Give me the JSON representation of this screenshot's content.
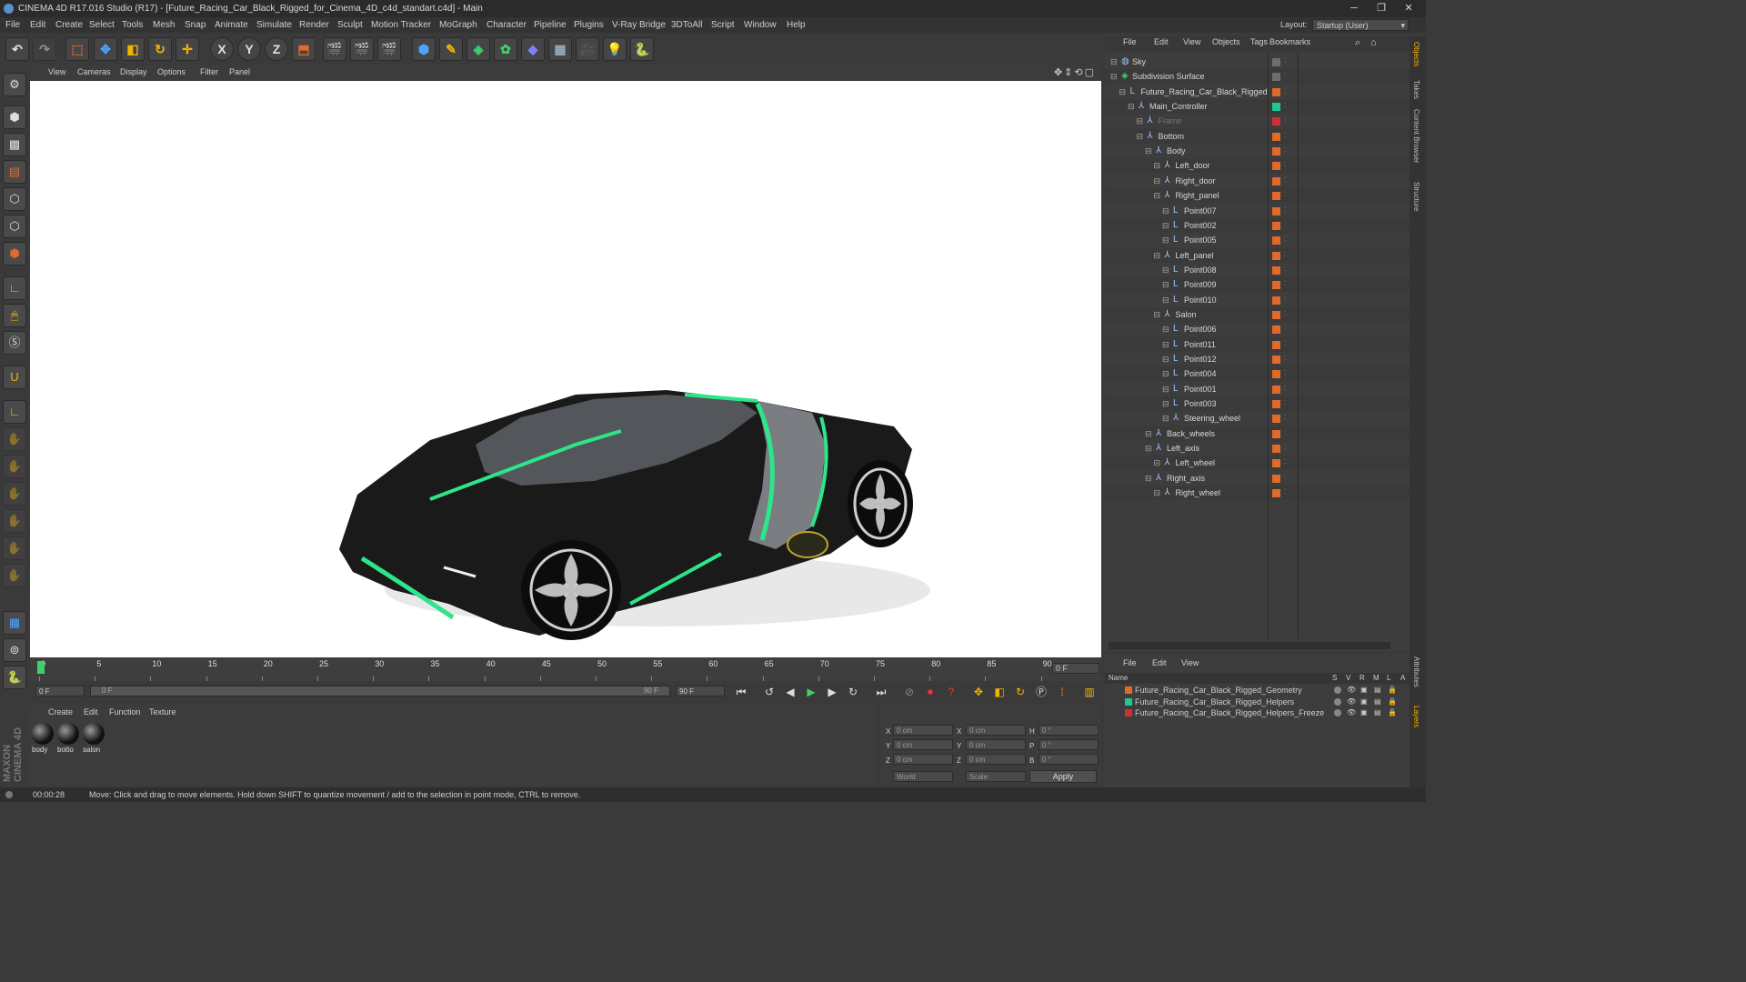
{
  "window": {
    "title": "CINEMA 4D R17.016 Studio (R17) - [Future_Racing_Car_Black_Rigged_for_Cinema_4D_c4d_standart.c4d] - Main",
    "min": "─",
    "max": "❐",
    "close": "✕"
  },
  "menu": [
    "File",
    "Edit",
    "Create",
    "Select",
    "Tools",
    "Mesh",
    "Snap",
    "Animate",
    "Simulate",
    "Render",
    "Sculpt",
    "Motion Tracker",
    "MoGraph",
    "Character",
    "Pipeline",
    "Plugins",
    "V-Ray Bridge",
    "3DToAll",
    "Script",
    "Window",
    "Help"
  ],
  "layout": {
    "label": "Layout:",
    "value": "Startup (User)"
  },
  "toolbar": {
    "x": "X",
    "y": "Y",
    "z": "Z"
  },
  "viewport_menu": [
    "View",
    "Cameras",
    "Display",
    "Options",
    "Filter",
    "Panel"
  ],
  "object_menu": [
    "File",
    "Edit",
    "View",
    "Objects",
    "Tags",
    "Bookmarks"
  ],
  "objects": [
    {
      "name": "Sky",
      "depth": 0,
      "icon": "sky-icon",
      "color": "#6e6e6e"
    },
    {
      "name": "Subdivision Surface",
      "depth": 0,
      "icon": "subdivision-icon",
      "color": "#6e6e6e"
    },
    {
      "name": "Future_Racing_Car_Black_Rigged",
      "depth": 1,
      "icon": "null-icon",
      "color": "#e06a2a"
    },
    {
      "name": "Main_Controller",
      "depth": 2,
      "icon": "joint-icon",
      "color": "#20c890"
    },
    {
      "name": "Frame",
      "depth": 3,
      "icon": "joint-icon",
      "color": "#d03030"
    },
    {
      "name": "Bottom",
      "depth": 3,
      "icon": "joint-icon",
      "color": "#e06a2a"
    },
    {
      "name": "Body",
      "depth": 4,
      "icon": "joint-icon",
      "color": "#e06a2a"
    },
    {
      "name": "Left_door",
      "depth": 5,
      "icon": "joint-icon",
      "color": "#e06a2a"
    },
    {
      "name": "Right_door",
      "depth": 5,
      "icon": "joint-icon",
      "color": "#e06a2a"
    },
    {
      "name": "Right_panel",
      "depth": 5,
      "icon": "joint-icon",
      "color": "#e06a2a"
    },
    {
      "name": "Point007",
      "depth": 6,
      "icon": "null-icon",
      "color": "#e06a2a"
    },
    {
      "name": "Point002",
      "depth": 6,
      "icon": "null-icon",
      "color": "#e06a2a"
    },
    {
      "name": "Point005",
      "depth": 6,
      "icon": "null-icon",
      "color": "#e06a2a"
    },
    {
      "name": "Left_panel",
      "depth": 5,
      "icon": "joint-icon",
      "color": "#e06a2a"
    },
    {
      "name": "Point008",
      "depth": 6,
      "icon": "null-icon",
      "color": "#e06a2a"
    },
    {
      "name": "Point009",
      "depth": 6,
      "icon": "null-icon",
      "color": "#e06a2a"
    },
    {
      "name": "Point010",
      "depth": 6,
      "icon": "null-icon",
      "color": "#e06a2a"
    },
    {
      "name": "Salon",
      "depth": 5,
      "icon": "joint-icon",
      "color": "#e06a2a"
    },
    {
      "name": "Point006",
      "depth": 6,
      "icon": "null-icon",
      "color": "#e06a2a"
    },
    {
      "name": "Point011",
      "depth": 6,
      "icon": "null-icon",
      "color": "#e06a2a"
    },
    {
      "name": "Point012",
      "depth": 6,
      "icon": "null-icon",
      "color": "#e06a2a"
    },
    {
      "name": "Point004",
      "depth": 6,
      "icon": "null-icon",
      "color": "#e06a2a"
    },
    {
      "name": "Point001",
      "depth": 6,
      "icon": "null-icon",
      "color": "#e06a2a"
    },
    {
      "name": "Point003",
      "depth": 6,
      "icon": "null-icon",
      "color": "#e06a2a"
    },
    {
      "name": "Steering_wheel",
      "depth": 6,
      "icon": "joint-icon",
      "color": "#e06a2a"
    },
    {
      "name": "Back_wheels",
      "depth": 4,
      "icon": "joint-icon",
      "color": "#e06a2a"
    },
    {
      "name": "Left_axis",
      "depth": 4,
      "icon": "joint-icon",
      "color": "#e06a2a"
    },
    {
      "name": "Left_wheel",
      "depth": 5,
      "icon": "joint-icon",
      "color": "#e06a2a"
    },
    {
      "name": "Right_axis",
      "depth": 4,
      "icon": "joint-icon",
      "color": "#e06a2a"
    },
    {
      "name": "Right_wheel",
      "depth": 5,
      "icon": "joint-icon",
      "color": "#e06a2a"
    }
  ],
  "layer_menu": [
    "File",
    "Edit",
    "View"
  ],
  "layer_header": {
    "name": "Name",
    "cols": [
      "S",
      "V",
      "R",
      "M",
      "L",
      "A"
    ]
  },
  "layers": [
    {
      "name": "Future_Racing_Car_Black_Rigged_Geometry",
      "color": "#e06a2a"
    },
    {
      "name": "Future_Racing_Car_Black_Rigged_Helpers",
      "color": "#20c890"
    },
    {
      "name": "Future_Racing_Car_Black_Rigged_Helpers_Freeze",
      "color": "#d03030"
    }
  ],
  "timeline": {
    "ticks": [
      "0",
      "5",
      "10",
      "15",
      "20",
      "25",
      "30",
      "35",
      "40",
      "45",
      "50",
      "55",
      "60",
      "65",
      "70",
      "75",
      "80",
      "85",
      "90"
    ],
    "end_frame": "0 F"
  },
  "transport": {
    "start": "0 F",
    "range_start": "0 F",
    "range_end": "90 F",
    "end": "90 F"
  },
  "mat_menu": [
    "Create",
    "Edit",
    "Function",
    "Texture"
  ],
  "materials": [
    "body",
    "botto",
    "salon"
  ],
  "coords": {
    "x": "X",
    "y": "Y",
    "z": "Z",
    "h": "H",
    "p": "P",
    "b": "B",
    "zero_cm": "0 cm",
    "zero_deg": "0 °",
    "world": "World",
    "scale": "Scale",
    "apply": "Apply"
  },
  "status": {
    "time": "00:00:28",
    "message": "Move: Click and drag to move elements. Hold down SHIFT to quantize movement / add to the selection in point mode, CTRL to remove."
  },
  "right_tabs": [
    "Objects",
    "Takes",
    "Content Browser",
    "Structure",
    "Attributes",
    "Layers"
  ],
  "brand": "MAXON CINEMA 4D"
}
